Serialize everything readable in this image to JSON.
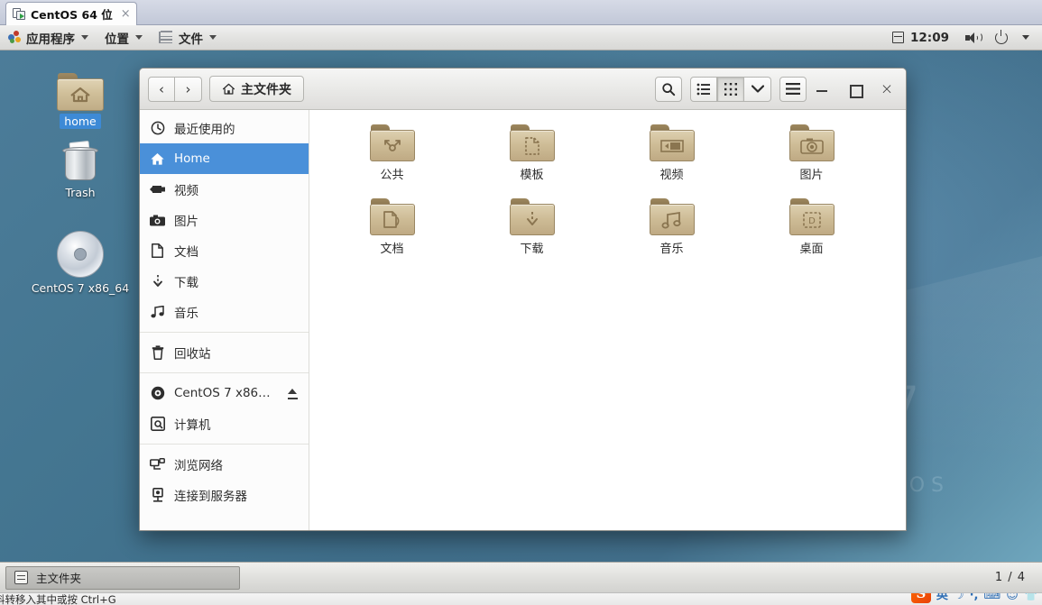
{
  "vmware": {
    "tab_label": "CentOS 64 位",
    "tab_icon": "vm-machine-icon",
    "close_icon": "×",
    "status_hint": "料转移入其中或按 Ctrl+G"
  },
  "gnome_panel": {
    "menus": [
      {
        "label": "应用程序",
        "icon": "applications-icon"
      },
      {
        "label": "位置",
        "icon": "places-icon"
      },
      {
        "label": "文件",
        "icon": "files-icon"
      }
    ],
    "clock": "12:09",
    "clock_icon": "calendar-icon",
    "volume_icon": "speaker-icon",
    "power_icon": "power-icon",
    "menu_caret": "▾"
  },
  "desktop": {
    "wallpaper_text_number": "7",
    "wallpaper_text_brand": "TOS",
    "icons": [
      {
        "label": "home",
        "icon": "home-folder-icon",
        "selected": true
      },
      {
        "label": "Trash",
        "icon": "trash-icon",
        "selected": false
      },
      {
        "label": "CentOS 7 x86_64",
        "icon": "cdrom-icon",
        "selected": false
      }
    ]
  },
  "window": {
    "path_label": "主文件夹",
    "path_icon": "home-icon",
    "nav_back_icon": "‹",
    "nav_forward_icon": "›",
    "toolbar": [
      {
        "name": "search-button",
        "icon": "search-icon",
        "active": false
      },
      {
        "name": "list-view-button",
        "icon": "list-view-icon",
        "active": false
      },
      {
        "name": "grid-view-button",
        "icon": "grid-view-icon",
        "active": true
      },
      {
        "name": "view-options-button",
        "icon": "chevron-down-icon",
        "active": false
      },
      {
        "name": "menu-button",
        "icon": "hamburger-menu-icon",
        "active": false
      }
    ],
    "window_buttons": [
      {
        "name": "minimize-button",
        "icon": "minimize-icon"
      },
      {
        "name": "maximize-button",
        "icon": "maximize-icon"
      },
      {
        "name": "close-button",
        "icon": "close-icon"
      }
    ],
    "sidebar": [
      {
        "label": "最近使用的",
        "icon": "clock-icon",
        "selected": false,
        "eject": false
      },
      {
        "label": "Home",
        "icon": "home-icon",
        "selected": true,
        "eject": false
      },
      {
        "label": "视频",
        "icon": "video-camera-icon",
        "selected": false,
        "eject": false
      },
      {
        "label": "图片",
        "icon": "camera-icon",
        "selected": false,
        "eject": false
      },
      {
        "label": "文档",
        "icon": "document-icon",
        "selected": false,
        "eject": false
      },
      {
        "label": "下载",
        "icon": "download-icon",
        "selected": false,
        "eject": false
      },
      {
        "label": "音乐",
        "icon": "music-note-icon",
        "selected": false,
        "eject": false
      },
      {
        "label": "回收站",
        "icon": "trash-icon",
        "selected": false,
        "eject": false
      },
      {
        "label": "CentOS 7 x86…",
        "icon": "disc-icon",
        "selected": false,
        "eject": true
      },
      {
        "label": "计算机",
        "icon": "computer-icon",
        "selected": false,
        "eject": false
      },
      {
        "label": "浏览网络",
        "icon": "network-icon",
        "selected": false,
        "eject": false
      },
      {
        "label": "连接到服务器",
        "icon": "server-connect-icon",
        "selected": false,
        "eject": false
      }
    ],
    "files": [
      {
        "name": "公共",
        "icon": "folder-public-icon"
      },
      {
        "name": "模板",
        "icon": "folder-templates-icon"
      },
      {
        "name": "视频",
        "icon": "folder-videos-icon"
      },
      {
        "name": "图片",
        "icon": "folder-pictures-icon"
      },
      {
        "name": "文档",
        "icon": "folder-documents-icon"
      },
      {
        "name": "下载",
        "icon": "folder-downloads-icon"
      },
      {
        "name": "音乐",
        "icon": "folder-music-icon"
      },
      {
        "name": "桌面",
        "icon": "folder-desktop-icon"
      }
    ]
  },
  "taskbar": {
    "window_button_label": "主文件夹",
    "window_button_icon": "window-icon",
    "workspace_indicator": "1 / 4"
  },
  "ime": {
    "logo": "S",
    "buttons": [
      "英",
      "☽",
      "·,",
      "⌨",
      "☺",
      "👕"
    ]
  },
  "colors": {
    "selection_blue": "#4a90d9",
    "panel_grey": "#e3e3e1",
    "folder_tan": "#cdbb95",
    "desktop_blue": "#447691"
  }
}
